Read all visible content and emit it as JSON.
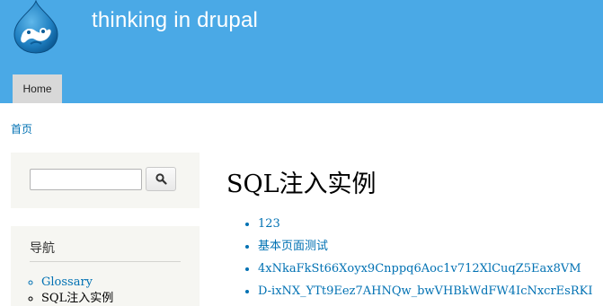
{
  "header": {
    "site_name": "thinking in drupal",
    "logo_icon": "drupal-drop-logo-icon",
    "background_color": "#4aa9e6"
  },
  "nav_tabs": [
    {
      "label": "Home",
      "active": true
    }
  ],
  "breadcrumb": {
    "home_label": "首页"
  },
  "sidebar": {
    "search": {
      "placeholder": "",
      "value": "",
      "button_icon": "search-icon"
    },
    "navigation": {
      "title": "导航",
      "items": [
        {
          "label": "Glossary"
        },
        {
          "label": "SQL注入实例"
        }
      ]
    }
  },
  "main": {
    "title": "SQL注入实例",
    "items": [
      {
        "label": "123"
      },
      {
        "label": "基本页面测试"
      },
      {
        "label": "4xNkaFkSt66Xoyx9Cnppq6Aoc1v712XlCuqZ5Eax8VM"
      },
      {
        "label": "D-ixNX_YTt9Eez7AHNQw_bwVHBkWdFW4IcNxcrEsRKI"
      }
    ]
  },
  "colors": {
    "link": "#0071b3",
    "sidebar_bg": "#f6f6f2"
  }
}
